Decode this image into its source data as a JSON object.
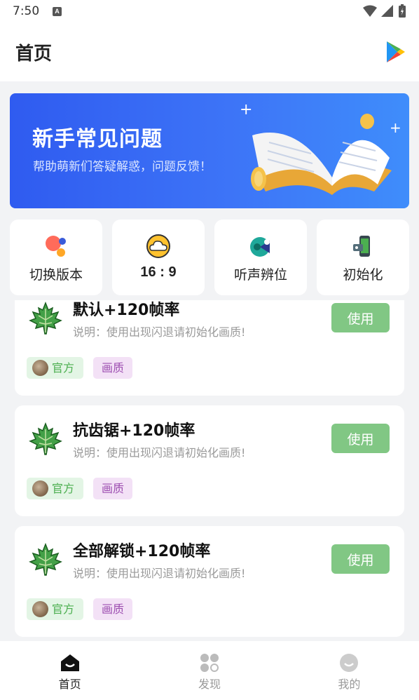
{
  "status_bar": {
    "time": "7:50",
    "notification_icon": "A"
  },
  "header": {
    "title": "首页",
    "right_icon": "play-store-icon"
  },
  "banner": {
    "title": "新手常见问题",
    "subtitle": "帮助萌新们答疑解惑，问题反馈！"
  },
  "quick_actions": [
    {
      "label": "切换版本",
      "icon": "switch-version-icon"
    },
    {
      "label": "16 : 9",
      "icon": "cloud-icon"
    },
    {
      "label": "听声辨位",
      "icon": "sound-locate-icon"
    },
    {
      "label": "初始化",
      "icon": "initialize-icon"
    }
  ],
  "configs": [
    {
      "title": "默认+120帧率",
      "desc": "说明：使用出现闪退请初始化画质!",
      "button": "使用",
      "tag_official": "官方",
      "tag_type": "画质"
    },
    {
      "title": "抗齿锯+120帧率",
      "desc": "说明：使用出现闪退请初始化画质!",
      "button": "使用",
      "tag_official": "官方",
      "tag_type": "画质"
    },
    {
      "title": "全部解锁+120帧率",
      "desc": "说明：使用出现闪退请初始化画质!",
      "button": "使用",
      "tag_official": "官方",
      "tag_type": "画质"
    }
  ],
  "bottom_nav": [
    {
      "label": "首页",
      "icon": "home-icon",
      "active": true
    },
    {
      "label": "发现",
      "icon": "discover-icon",
      "active": false
    },
    {
      "label": "我的",
      "icon": "profile-icon",
      "active": false
    }
  ],
  "colors": {
    "accent_green": "#81c784",
    "banner_blue": "#3d74f7",
    "tag_green": "#4caf50",
    "tag_purple": "#9c4db0"
  }
}
